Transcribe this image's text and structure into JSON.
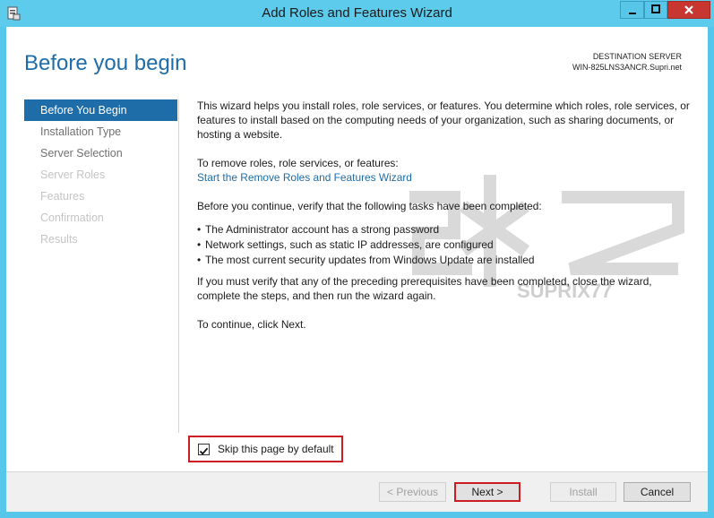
{
  "window": {
    "title": "Add Roles and Features Wizard",
    "icon": "server-manager-icon",
    "controls": [
      "minimize-icon",
      "maximize-icon",
      "close-icon"
    ]
  },
  "header": {
    "page_title": "Before you begin",
    "destination_label": "DESTINATION SERVER",
    "destination_server": "WIN-825LNS3ANCR.Supri.net"
  },
  "nav": {
    "items": [
      {
        "label": "Before You Begin",
        "state": "active"
      },
      {
        "label": "Installation Type",
        "state": "enabled"
      },
      {
        "label": "Server Selection",
        "state": "enabled"
      },
      {
        "label": "Server Roles",
        "state": "disabled"
      },
      {
        "label": "Features",
        "state": "disabled"
      },
      {
        "label": "Confirmation",
        "state": "disabled"
      },
      {
        "label": "Results",
        "state": "disabled"
      }
    ]
  },
  "content": {
    "intro": "This wizard helps you install roles, role services, or features. You determine which roles, role services, or features to install based on the computing needs of your organization, such as sharing documents, or hosting a website.",
    "remove_text": "To remove roles, role services, or features:",
    "remove_link": "Start the Remove Roles and Features Wizard",
    "verify_text": "Before you continue, verify that the following tasks have been completed:",
    "bullets": [
      "The Administrator account has a strong password",
      "Network settings, such as static IP addresses, are configured",
      "The most current security updates from Windows Update are installed"
    ],
    "prereq_text": "If you must verify that any of the preceding prerequisites have been completed, close the wizard, complete the steps, and then run the wizard again.",
    "continue_text": "To continue, click Next."
  },
  "skip": {
    "label": "Skip this page by default",
    "checked": true
  },
  "footer": {
    "previous": "< Previous",
    "next": "Next >",
    "install": "Install",
    "cancel": "Cancel"
  },
  "watermark": {
    "text": "SUPRIX77"
  },
  "colors": {
    "titlebar": "#5dcbec",
    "accent": "#1e6ca8",
    "highlight_border": "#cc1d25",
    "close_button": "#c7372f"
  }
}
